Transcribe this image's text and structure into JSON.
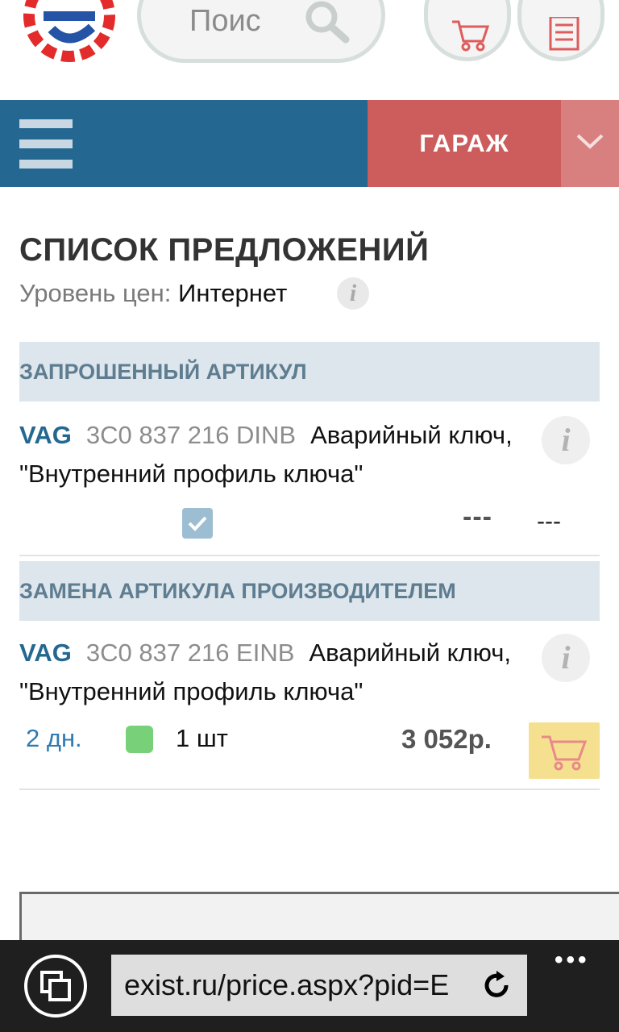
{
  "header": {
    "search_placeholder": "Поис",
    "icons": [
      "logo-icon",
      "search-icon",
      "cart-icon",
      "list-icon"
    ]
  },
  "nav": {
    "garage_label": "ГАРАЖ",
    "menu_icon": "hamburger-icon",
    "toggle_icon": "chevron-down-icon"
  },
  "page": {
    "title": "СПИСОК ПРЕДЛОЖЕНИЙ",
    "price_level_label": "Уровень цен:",
    "price_level_value": "Интернет",
    "info_glyph": "i"
  },
  "requested": {
    "section_title": "ЗАПРОШЕННЫЙ АРТИКУЛ",
    "brand": "VAG",
    "code": "3C0 837 216 DINB",
    "description": "Аварийный ключ, \"Внутренний профиль ключа\"",
    "checked": true,
    "price": "---",
    "availability": "---"
  },
  "replacement": {
    "section_title": "ЗАМЕНА АРТИКУЛА ПРОИЗВОДИТЕЛЕМ",
    "brand": "VAG",
    "code": "3C0 837 216 EINB",
    "description": "Аварийный ключ, \"Внутренний профиль ключа\"",
    "delivery": "2 дн.",
    "quantity": "1 шт",
    "price": "3 052р.",
    "stock_color": "#78d078"
  },
  "browser": {
    "url": "exist.ru/price.aspx?pid=E",
    "more": "•••"
  },
  "colors": {
    "nav_blue": "#246892",
    "garage_red": "#cd5c5c",
    "section_bg": "#dce6ec",
    "cart_yellow": "#f5e08f"
  }
}
